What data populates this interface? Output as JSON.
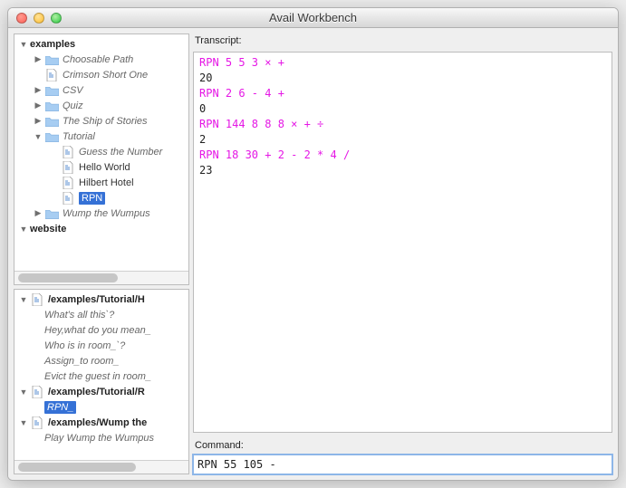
{
  "window": {
    "title": "Avail Workbench"
  },
  "tree": {
    "roots": [
      {
        "label": "examples",
        "level": 0,
        "bold": true,
        "open": true,
        "kind": "root",
        "children": [
          {
            "label": "Choosable Path",
            "level": 1,
            "italic": true,
            "open": false,
            "kind": "folder"
          },
          {
            "label": "Crimson Short One",
            "level": 1,
            "italic": true,
            "open": null,
            "kind": "file"
          },
          {
            "label": "CSV",
            "level": 1,
            "italic": true,
            "open": false,
            "kind": "folder"
          },
          {
            "label": "Quiz",
            "level": 1,
            "italic": true,
            "open": false,
            "kind": "folder"
          },
          {
            "label": "The Ship of Stories",
            "level": 1,
            "italic": true,
            "open": false,
            "kind": "folder"
          },
          {
            "label": "Tutorial",
            "level": 1,
            "italic": true,
            "open": true,
            "kind": "folder",
            "children": [
              {
                "label": "Guess the Number",
                "level": 2,
                "italic": true,
                "open": null,
                "kind": "file"
              },
              {
                "label": "Hello World",
                "level": 2,
                "italic": false,
                "open": null,
                "kind": "file"
              },
              {
                "label": "Hilbert Hotel",
                "level": 2,
                "italic": false,
                "open": null,
                "kind": "file"
              },
              {
                "label": "RPN",
                "level": 2,
                "italic": false,
                "open": null,
                "kind": "file",
                "selected": true
              }
            ]
          },
          {
            "label": "Wump the Wumpus",
            "level": 1,
            "italic": true,
            "open": false,
            "kind": "folder"
          }
        ]
      },
      {
        "label": "website",
        "level": 0,
        "bold": true,
        "open": true,
        "kind": "root"
      }
    ]
  },
  "bottomTree": [
    {
      "label": "/examples/Tutorial/H",
      "level": 0,
      "bold": true,
      "open": true,
      "kind": "file",
      "children": [
        {
          "label": "What's all this`?",
          "level": 1,
          "italic": true
        },
        {
          "label": "Hey,what do you mean_",
          "level": 1,
          "italic": true
        },
        {
          "label": "Who is in room_`?",
          "level": 1,
          "italic": true
        },
        {
          "label": "Assign_to room_",
          "level": 1,
          "italic": true
        },
        {
          "label": "Evict the guest in room_",
          "level": 1,
          "italic": true
        }
      ]
    },
    {
      "label": "/examples/Tutorial/R",
      "level": 0,
      "bold": true,
      "open": true,
      "kind": "file",
      "children": [
        {
          "label": "RPN_",
          "level": 1,
          "italic": true,
          "selected": true
        }
      ]
    },
    {
      "label": "/examples/Wump the",
      "level": 0,
      "bold": true,
      "open": true,
      "kind": "file",
      "children": [
        {
          "label": "Play Wump the Wumpus",
          "level": 1,
          "italic": true
        }
      ]
    }
  ],
  "transcript": {
    "label": "Transcript:",
    "lines": [
      {
        "t": "RPN 5 5 3 × +",
        "c": "cmd"
      },
      {
        "t": "20",
        "c": "out"
      },
      {
        "t": "RPN 2 6 - 4 +",
        "c": "cmd"
      },
      {
        "t": "0",
        "c": "out"
      },
      {
        "t": "RPN 144 8 8 8 × + ÷",
        "c": "cmd"
      },
      {
        "t": "2",
        "c": "out"
      },
      {
        "t": "RPN 18 30 + 2 - 2 * 4 /",
        "c": "cmd"
      },
      {
        "t": "23",
        "c": "out"
      }
    ]
  },
  "command": {
    "label": "Command:",
    "value": "RPN 55 105 -"
  }
}
